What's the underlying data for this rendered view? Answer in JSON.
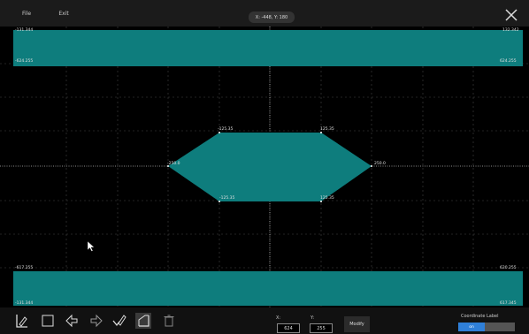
{
  "menu": {
    "file": "File",
    "exit": "Exit"
  },
  "cursor_readout": "X: -448, Y: 180",
  "labels": {
    "top_left_upper": "-131.344",
    "top_right_upper": "132.342",
    "top_left_lower": "-624.255",
    "top_right_lower": "624.255",
    "hex_top_left": "-125.35",
    "hex_top_right": "125.35",
    "hex_left": "-250.0",
    "hex_right": "250.0",
    "hex_bot_left": "-125.35",
    "hex_bot_right": "125.35",
    "bottom_left_upper": "-617.255",
    "bottom_right_upper": "620.255",
    "bottom_left_lower": "-131.344",
    "bottom_right_lower": "617.345"
  },
  "toolbar": {
    "tools": [
      "pen-point-icon",
      "rectangle-icon",
      "undo-icon",
      "redo-icon",
      "pen-check-icon",
      "region-icon",
      "trash-icon"
    ]
  },
  "coords": {
    "x_label": "X:",
    "y_label": "Y:",
    "x_value": "624",
    "y_value": "255"
  },
  "modify_label": "Modify",
  "coordinate_label": {
    "title": "Coordinate Label",
    "state": "on"
  },
  "colors": {
    "mask_fill": "#0e7d7d",
    "grid": "#555555",
    "background": "#000000"
  }
}
